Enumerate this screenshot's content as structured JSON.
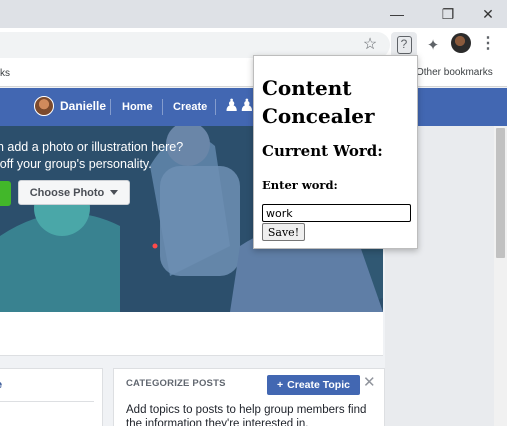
{
  "browser": {
    "bookmarks_left_partial": "ks",
    "other_bookmarks": "Other bookmarks",
    "icons": [
      "minimize-icon",
      "maximize-icon",
      "close-icon",
      "star-icon",
      "help-extension-icon",
      "puzzle-icon",
      "profile-avatar",
      "more-menu-icon",
      "folder-icon"
    ]
  },
  "fb_nav": {
    "user_name": "Danielle",
    "home": "Home",
    "create": "Create"
  },
  "cover": {
    "line1": "an add a photo or illustration here?",
    "line2": "s off your group's personality.",
    "choose_photo": "Choose Photo"
  },
  "cards": {
    "left_link_partial": "e",
    "categorize_title": "CATEGORIZE POSTS",
    "create_topic": "Create Topic",
    "description": "Add topics to posts to help group members find the information they're interested in."
  },
  "popup": {
    "title": "Content Concealer",
    "current_word_label": "Current Word:",
    "enter_word_label": "Enter word:",
    "input_value": "work",
    "save_label": "Save!"
  },
  "colors": {
    "fb_blue": "#4267b2",
    "green": "#42b72a"
  }
}
